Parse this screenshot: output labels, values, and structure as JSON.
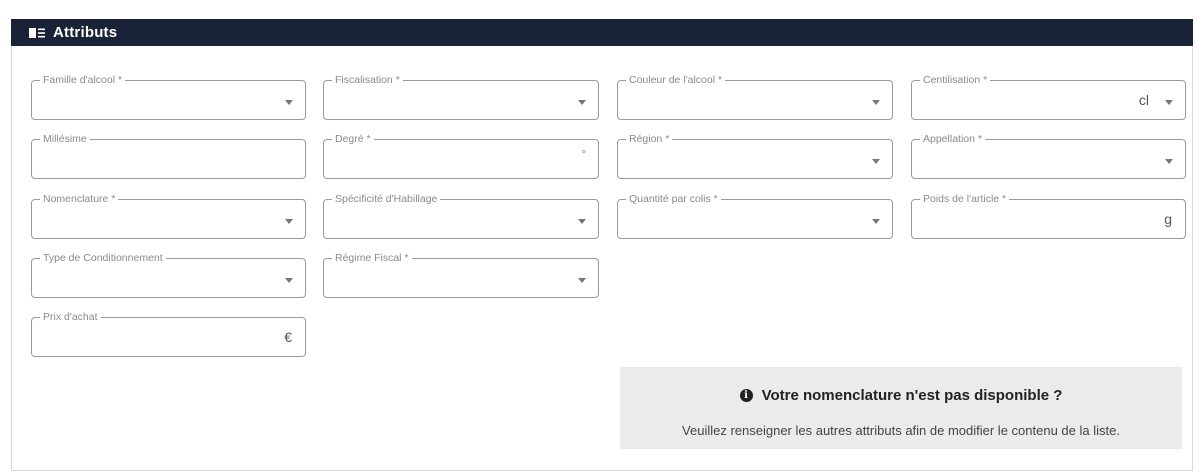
{
  "panel": {
    "title": "Attributs",
    "icon": "list-view-icon"
  },
  "fields": [
    {
      "key": "famille",
      "label": "Famille d'alcool *",
      "type": "select",
      "value": ""
    },
    {
      "key": "fiscalisation",
      "label": "Fiscalisation *",
      "type": "select",
      "value": ""
    },
    {
      "key": "couleur",
      "label": "Couleur de l'alcool *",
      "type": "select",
      "value": ""
    },
    {
      "key": "centilisation",
      "label": "Centilisation *",
      "type": "select",
      "suffix": "cl",
      "value": ""
    },
    {
      "key": "millesime",
      "label": "Millésime",
      "type": "input",
      "value": ""
    },
    {
      "key": "degre",
      "label": "Degré *",
      "type": "input",
      "suffix": "°",
      "value": ""
    },
    {
      "key": "region",
      "label": "Région *",
      "type": "select",
      "value": ""
    },
    {
      "key": "appellation",
      "label": "Appellation *",
      "type": "select",
      "value": ""
    },
    {
      "key": "nomenclature",
      "label": "Nomenclature *",
      "type": "select",
      "value": ""
    },
    {
      "key": "habillage",
      "label": "Spécificité d'Habillage",
      "type": "select",
      "value": ""
    },
    {
      "key": "quantite",
      "label": "Quantité par colis *",
      "type": "select",
      "value": ""
    },
    {
      "key": "poids",
      "label": "Poids de l'article *",
      "type": "input",
      "suffix": "g",
      "value": ""
    },
    {
      "key": "conditionnement",
      "label": "Type de Conditionnement",
      "type": "select",
      "value": ""
    },
    {
      "key": "regime",
      "label": "Régime Fiscal *",
      "type": "select",
      "value": ""
    },
    {
      "key": "prix",
      "label": "Prix d'achat",
      "type": "input",
      "suffix": "€",
      "value": ""
    }
  ],
  "info": {
    "icon": "info-circle-icon",
    "title": "Votre nomenclature n'est pas disponible ?",
    "text": "Veuillez renseigner les autres attributs afin de modifier le contenu de la liste."
  },
  "colors": {
    "header_bg": "#1a2238",
    "header_text": "#ffffff",
    "info_bg": "#ebebeb",
    "field_border": "#9a9a9a"
  }
}
